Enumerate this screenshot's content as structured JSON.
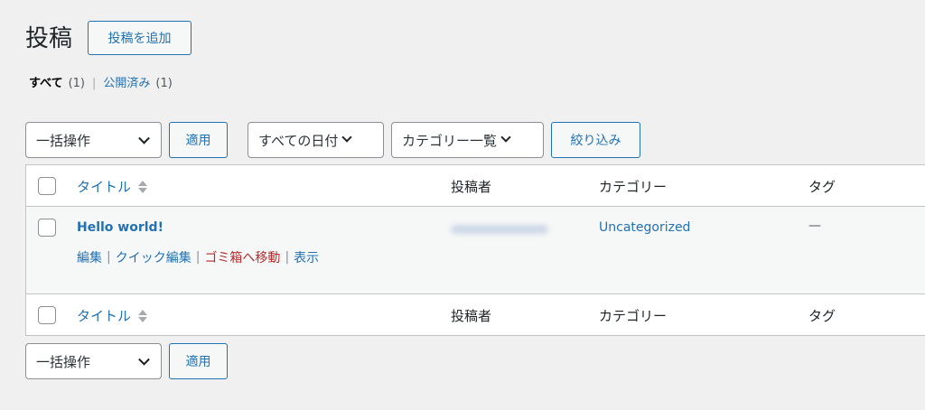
{
  "header": {
    "title": "投稿",
    "add_new_label": "投稿を追加"
  },
  "views": {
    "all_label": "すべて",
    "all_count": "(1)",
    "published_label": "公開済み",
    "published_count": "(1)"
  },
  "tablenav_top": {
    "bulk_action": "一括操作",
    "apply_label": "適用",
    "date_filter": "すべての日付",
    "category_filter": "カテゴリー一覧",
    "filter_label": "絞り込み"
  },
  "table": {
    "columns": {
      "title": "タイトル",
      "author": "投稿者",
      "categories": "カテゴリー",
      "tags": "タグ"
    },
    "rows": [
      {
        "title": "Hello world!",
        "actions": {
          "edit": "編集",
          "quick_edit": "クイック編集",
          "trash": "ゴミ箱へ移動",
          "view": "表示"
        },
        "category": "Uncategorized",
        "tags": "—"
      }
    ]
  },
  "tablenav_bottom": {
    "bulk_action": "一括操作",
    "apply_label": "適用"
  },
  "colors": {
    "link": "#2271b1",
    "trash": "#b32d2e",
    "background": "#f0f0f1"
  }
}
